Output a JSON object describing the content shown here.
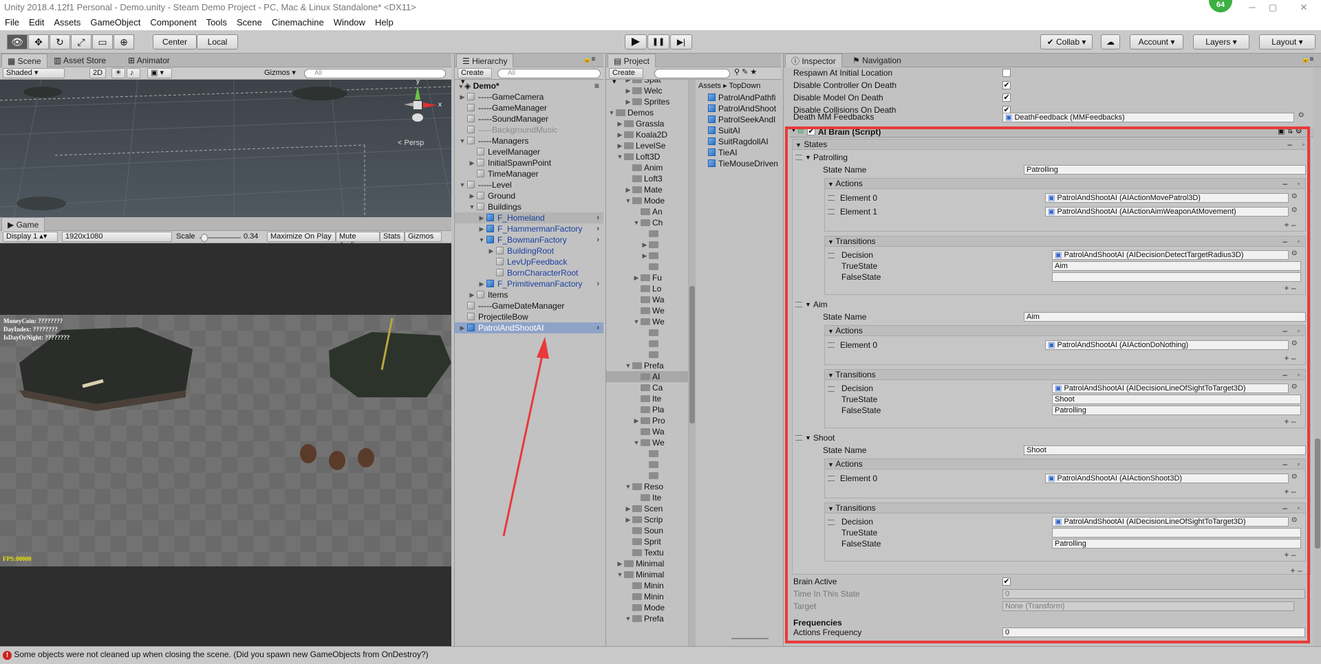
{
  "window": {
    "title": "Unity 2018.4.12f1 Personal - Demo.unity - Steam Demo Project - PC, Mac & Linux Standalone* <DX11>",
    "badge": "64",
    "min": "─",
    "max": "▢",
    "close": "✕"
  },
  "menu": [
    "File",
    "Edit",
    "Assets",
    "GameObject",
    "Component",
    "Tools",
    "Scene",
    "Cinemachine",
    "Window",
    "Help"
  ],
  "toolbar": {
    "center": "Center",
    "local": "Local",
    "collab": "Collab",
    "account": "Account",
    "layers": "Layers",
    "layout": "Layout",
    "play": "▶",
    "pause": "❚❚",
    "step": "▶|"
  },
  "scene": {
    "tabs": [
      "Scene",
      "Asset Store",
      "Animator"
    ],
    "shading": "Shaded",
    "mode2d": "2D",
    "gizmos": "Gizmos",
    "search": "All",
    "persp": "< Persp",
    "axis_y": "y",
    "axis_x": "x"
  },
  "game": {
    "tab": "Game",
    "display": "Display 1",
    "resolution": "1920x1080",
    "scale_label": "Scale",
    "scale_value": "0.34",
    "scale_fraction": 0.34,
    "buttons": [
      "Maximize On Play",
      "Mute Audio",
      "Stats",
      "Gizmos"
    ],
    "hud": [
      "MoneyCoin: ????????",
      "DayIndex: ????????",
      "IsDayOrNight: ????????"
    ],
    "fps": "FPS:00000"
  },
  "hierarchy": {
    "tab": "Hierarchy",
    "create": "Create",
    "search": "All",
    "root": "Demo*",
    "items": [
      {
        "label": "-----GameCamera",
        "depth": 1,
        "arrow": "▶",
        "icon": "gray"
      },
      {
        "label": "-----GameManager",
        "depth": 1,
        "arrow": "",
        "icon": "gray"
      },
      {
        "label": "-----SoundManager",
        "depth": 1,
        "arrow": "",
        "icon": "gray"
      },
      {
        "label": "-----BackgroundMusic",
        "depth": 1,
        "arrow": "",
        "icon": "gray",
        "dim": true
      },
      {
        "label": "-----Managers",
        "depth": 1,
        "arrow": "▼",
        "icon": "gray"
      },
      {
        "label": "LevelManager",
        "depth": 2,
        "arrow": "",
        "icon": "gray"
      },
      {
        "label": "InitialSpawnPoint",
        "depth": 2,
        "arrow": "▶",
        "icon": "gray"
      },
      {
        "label": "TimeManager",
        "depth": 2,
        "arrow": "",
        "icon": "gray"
      },
      {
        "label": "-----Level",
        "depth": 1,
        "arrow": "▼",
        "icon": "gray"
      },
      {
        "label": "Ground",
        "depth": 2,
        "arrow": "▶",
        "icon": "gray"
      },
      {
        "label": "Buildings",
        "depth": 2,
        "arrow": "▼",
        "icon": "gray"
      },
      {
        "label": "F_Homeland",
        "depth": 3,
        "arrow": "▶",
        "icon": "blue",
        "prefab": true,
        "chev": true,
        "sel": true
      },
      {
        "label": "F_HammermanFactory",
        "depth": 3,
        "arrow": "▶",
        "icon": "blue",
        "prefab": true,
        "chev": true
      },
      {
        "label": "F_BowmanFactory",
        "depth": 3,
        "arrow": "▼",
        "icon": "blue",
        "prefab": true,
        "chev": true
      },
      {
        "label": "BuildingRoot",
        "depth": 4,
        "arrow": "▶",
        "icon": "gray",
        "prefab": true
      },
      {
        "label": "LevUpFeedback",
        "depth": 4,
        "arrow": "",
        "icon": "gray",
        "prefab": true
      },
      {
        "label": "BornCharacterRoot",
        "depth": 4,
        "arrow": "",
        "icon": "gray",
        "prefab": true
      },
      {
        "label": "F_PrimitivemanFactory",
        "depth": 3,
        "arrow": "▶",
        "icon": "blue",
        "prefab": true,
        "chev": true
      },
      {
        "label": "Items",
        "depth": 2,
        "arrow": "▶",
        "icon": "gray"
      },
      {
        "label": "-----GameDateManager",
        "depth": 1,
        "arrow": "",
        "icon": "gray"
      },
      {
        "label": "ProjectileBow",
        "depth": 1,
        "arrow": "",
        "icon": "gray"
      },
      {
        "label": "PatrolAndShootAI",
        "depth": 1,
        "arrow": "▶",
        "icon": "blue",
        "prefab": true,
        "chev": true,
        "selected": true
      }
    ]
  },
  "project": {
    "tab": "Project",
    "create": "Create",
    "breadcrumb": [
      "Assets",
      "TopDown"
    ],
    "tree": [
      {
        "label": "Spat",
        "depth": 3,
        "arrow": "▶"
      },
      {
        "label": "Welc",
        "depth": 3,
        "arrow": "▶"
      },
      {
        "label": "Sprites",
        "depth": 3,
        "arrow": "▶"
      },
      {
        "label": "Demos",
        "depth": 1,
        "arrow": "▼"
      },
      {
        "label": "Grassla",
        "depth": 2,
        "arrow": "▶"
      },
      {
        "label": "Koala2D",
        "depth": 2,
        "arrow": "▶"
      },
      {
        "label": "LevelSe",
        "depth": 2,
        "arrow": "▶"
      },
      {
        "label": "Loft3D",
        "depth": 2,
        "arrow": "▼"
      },
      {
        "label": "Anim",
        "depth": 3,
        "arrow": ""
      },
      {
        "label": "Loft3",
        "depth": 3,
        "arrow": ""
      },
      {
        "label": "Mate",
        "depth": 3,
        "arrow": "▶"
      },
      {
        "label": "Mode",
        "depth": 3,
        "arrow": "▼"
      },
      {
        "label": "An",
        "depth": 4,
        "arrow": ""
      },
      {
        "label": "Ch",
        "depth": 4,
        "arrow": "▼"
      },
      {
        "label": "",
        "depth": 5,
        "arrow": ""
      },
      {
        "label": "",
        "depth": 5,
        "arrow": "▶"
      },
      {
        "label": "",
        "depth": 5,
        "arrow": "▶"
      },
      {
        "label": "",
        "depth": 5,
        "arrow": ""
      },
      {
        "label": "Fu",
        "depth": 4,
        "arrow": "▶"
      },
      {
        "label": "Lo",
        "depth": 4,
        "arrow": ""
      },
      {
        "label": "Wa",
        "depth": 4,
        "arrow": ""
      },
      {
        "label": "We",
        "depth": 4,
        "arrow": ""
      },
      {
        "label": "We",
        "depth": 4,
        "arrow": "▼"
      },
      {
        "label": "",
        "depth": 5,
        "arrow": ""
      },
      {
        "label": "",
        "depth": 5,
        "arrow": ""
      },
      {
        "label": "",
        "depth": 5,
        "arrow": ""
      },
      {
        "label": "Prefa",
        "depth": 3,
        "arrow": "▼"
      },
      {
        "label": "AI",
        "depth": 4,
        "arrow": "",
        "sel": true
      },
      {
        "label": "Ca",
        "depth": 4,
        "arrow": ""
      },
      {
        "label": "Ite",
        "depth": 4,
        "arrow": ""
      },
      {
        "label": "Pla",
        "depth": 4,
        "arrow": ""
      },
      {
        "label": "Pro",
        "depth": 4,
        "arrow": "▶"
      },
      {
        "label": "Wa",
        "depth": 4,
        "arrow": ""
      },
      {
        "label": "We",
        "depth": 4,
        "arrow": "▼"
      },
      {
        "label": "",
        "depth": 5,
        "arrow": ""
      },
      {
        "label": "",
        "depth": 5,
        "arrow": ""
      },
      {
        "label": "",
        "depth": 5,
        "arrow": ""
      },
      {
        "label": "Reso",
        "depth": 3,
        "arrow": "▼"
      },
      {
        "label": "Ite",
        "depth": 4,
        "arrow": ""
      },
      {
        "label": "Scen",
        "depth": 3,
        "arrow": "▶"
      },
      {
        "label": "Scrip",
        "depth": 3,
        "arrow": "▶"
      },
      {
        "label": "Soun",
        "depth": 3,
        "arrow": ""
      },
      {
        "label": "Sprit",
        "depth": 3,
        "arrow": ""
      },
      {
        "label": "Textu",
        "depth": 3,
        "arrow": ""
      },
      {
        "label": "Minimal",
        "depth": 2,
        "arrow": "▶"
      },
      {
        "label": "Minimal",
        "depth": 2,
        "arrow": "▼"
      },
      {
        "label": "Minin",
        "depth": 3,
        "arrow": ""
      },
      {
        "label": "Minin",
        "depth": 3,
        "arrow": ""
      },
      {
        "label": "Mode",
        "depth": 3,
        "arrow": ""
      },
      {
        "label": "Prefa",
        "depth": 3,
        "arrow": "▼"
      }
    ],
    "assets": [
      "PatrolAndPathfi",
      "PatrolAndShoot",
      "PatrolSeekAndI",
      "SuitAI",
      "SuitRagdollAI",
      "TieAI",
      "TieMouseDriven"
    ]
  },
  "inspector": {
    "tabs": [
      "Inspector",
      "Navigation"
    ],
    "top_rows": [
      {
        "label": "Respawn At Initial Location",
        "checked": false
      },
      {
        "label": "Disable Controller On Death",
        "checked": true
      },
      {
        "label": "Disable Model On Death",
        "checked": true
      },
      {
        "label": "Disable Collisions On Death",
        "checked": true
      }
    ],
    "death_feedback": {
      "label": "Death MM Feedbacks",
      "value": "DeathFeedback (MMFeedbacks)"
    },
    "component_title": "AI Brain (Script)",
    "states_label": "States",
    "state_name_label": "State Name",
    "actions_label": "Actions",
    "transitions_label": "Transitions",
    "decision_label": "Decision",
    "true_label": "TrueState",
    "false_label": "FalseState",
    "states": [
      {
        "name": "Patrolling",
        "actions": [
          {
            "label": "Element 0",
            "value": "PatrolAndShootAI (AIActionMovePatrol3D)"
          },
          {
            "label": "Element 1",
            "value": "PatrolAndShootAI (AIActionAimWeaponAtMovement)"
          }
        ],
        "decision": "PatrolAndShootAI (AIDecisionDetectTargetRadius3D)",
        "true_state": "Aim",
        "false_state": ""
      },
      {
        "name": "Aim",
        "actions": [
          {
            "label": "Element 0",
            "value": "PatrolAndShootAI (AIActionDoNothing)"
          }
        ],
        "decision": "PatrolAndShootAI (AIDecisionLineOfSightToTarget3D)",
        "true_state": "Shoot",
        "false_state": "Patrolling"
      },
      {
        "name": "Shoot",
        "actions": [
          {
            "label": "Element 0",
            "value": "PatrolAndShootAI (AIActionShoot3D)"
          }
        ],
        "decision": "PatrolAndShootAI (AIDecisionLineOfSightToTarget3D)",
        "true_state": "",
        "false_state": "Patrolling"
      }
    ],
    "brain_active": {
      "label": "Brain Active",
      "checked": true
    },
    "time_in_state": {
      "label": "Time In This State",
      "value": "0"
    },
    "target": {
      "label": "Target",
      "value": "None (Transform)"
    },
    "frequencies_header": "Frequencies",
    "actions_frequency": {
      "label": "Actions Frequency",
      "value": "0"
    }
  },
  "status": {
    "message": "Some objects were not cleaned up when closing the scene. (Did you spawn new GameObjects from OnDestroy?)"
  },
  "colors": {
    "highlight": "#e83a3a",
    "selection": "#8fa3c8",
    "prefab_text": "#1a3fa0",
    "accent_green": "#3cb043"
  }
}
